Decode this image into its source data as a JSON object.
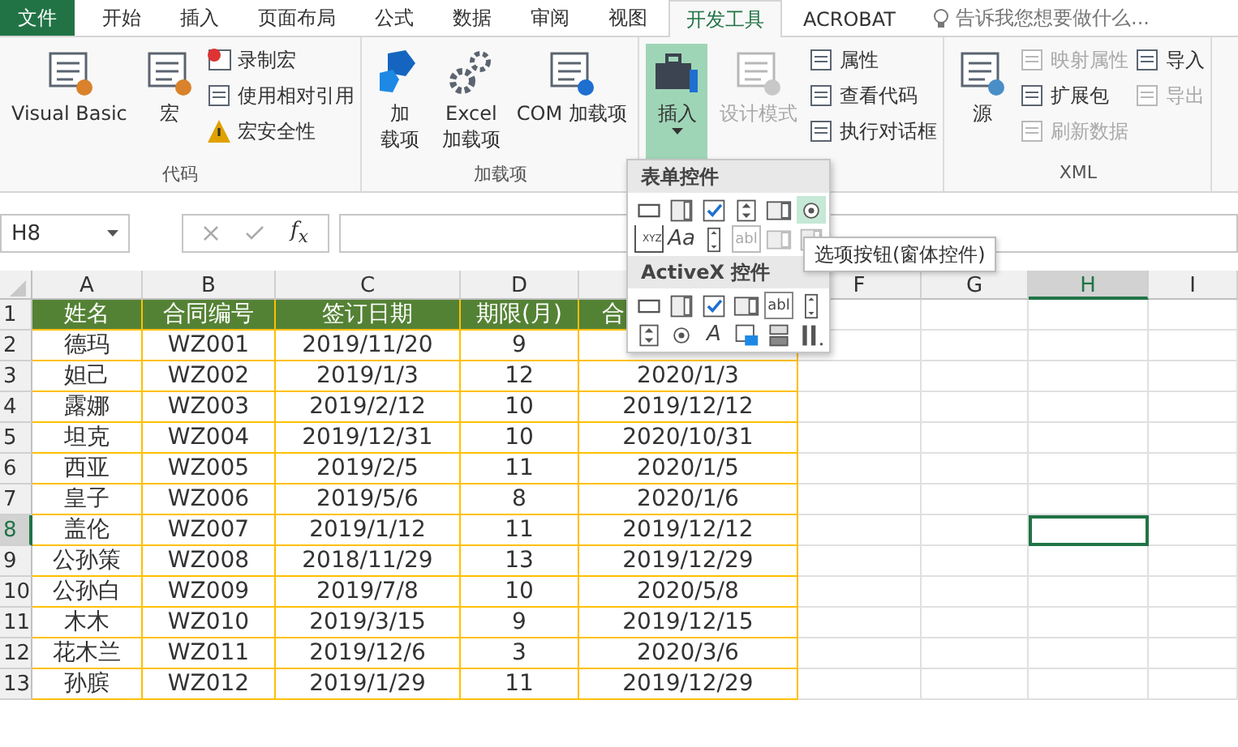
{
  "tabs": [
    {
      "label": "文件",
      "kind": "file",
      "selected": false
    },
    {
      "label": "开始",
      "kind": "tab",
      "selected": false
    },
    {
      "label": "插入",
      "kind": "tab",
      "selected": false
    },
    {
      "label": "页面布局",
      "kind": "tab",
      "selected": false
    },
    {
      "label": "公式",
      "kind": "tab",
      "selected": false
    },
    {
      "label": "数据",
      "kind": "tab",
      "selected": false
    },
    {
      "label": "审阅",
      "kind": "tab",
      "selected": false
    },
    {
      "label": "视图",
      "kind": "tab",
      "selected": false
    },
    {
      "label": "开发工具",
      "kind": "tab",
      "selected": true
    },
    {
      "label": "ACROBAT",
      "kind": "tab",
      "selected": false
    }
  ],
  "tell_me": {
    "placeholder": "告诉我您想要做什么..."
  },
  "ribbon": {
    "groups": [
      {
        "label": "代码",
        "columns": [
          {
            "kind": "large",
            "items": [
              {
                "lines": [
                  "Visual Basic"
                ],
                "disabled": false
              }
            ]
          },
          {
            "kind": "large",
            "items": [
              {
                "lines": [
                  "宏"
                ],
                "disabled": false
              }
            ]
          },
          {
            "kind": "stack",
            "items": [
              {
                "lines": [
                  "录制宏"
                ],
                "disabled": false
              },
              {
                "lines": [
                  "使用相对引用"
                ],
                "disabled": false
              },
              {
                "lines": [
                  "宏安全性"
                ],
                "disabled": false
              }
            ]
          }
        ]
      },
      {
        "label": "加载项",
        "columns": [
          {
            "kind": "large",
            "items": [
              {
                "lines": [
                  "加",
                  "载项"
                ],
                "disabled": false
              }
            ]
          },
          {
            "kind": "large",
            "items": [
              {
                "lines": [
                  "Excel",
                  "加载项"
                ],
                "disabled": false
              }
            ]
          },
          {
            "kind": "large",
            "items": [
              {
                "lines": [
                  "COM 加载项"
                ],
                "disabled": false
              }
            ]
          }
        ]
      },
      {
        "columns": [
          {
            "kind": "large",
            "items": [
              {
                "lines": [
                  "插入"
                ],
                "disabled": false,
                "selected": true,
                "dropdown": true
              }
            ]
          },
          {
            "kind": "large",
            "items": [
              {
                "lines": [
                  "设计模式"
                ],
                "disabled": true
              }
            ]
          },
          {
            "kind": "stack",
            "items": [
              {
                "lines": [
                  "属性"
                ],
                "disabled": false
              },
              {
                "lines": [
                  "查看代码"
                ],
                "disabled": false
              },
              {
                "lines": [
                  "执行对话框"
                ],
                "disabled": false
              }
            ]
          }
        ]
      },
      {
        "label": "XML",
        "columns": [
          {
            "kind": "large",
            "items": [
              {
                "lines": [
                  "源"
                ],
                "disabled": false
              }
            ]
          },
          {
            "kind": "stack",
            "items": [
              {
                "lines": [
                  "映射属性"
                ],
                "disabled": true
              },
              {
                "lines": [
                  "扩展包"
                ],
                "disabled": false
              },
              {
                "lines": [
                  "刷新数据"
                ],
                "disabled": true
              }
            ]
          },
          {
            "kind": "stack",
            "items": [
              {
                "lines": [
                  "导入"
                ],
                "disabled": false
              },
              {
                "lines": [
                  "导出"
                ],
                "disabled": true
              }
            ]
          }
        ]
      }
    ]
  },
  "formula_bar": {
    "name_box": "H8",
    "fx": "f$_{x}$"
  },
  "sheet": {
    "columns": [
      {
        "label": "A",
        "selected": false
      },
      {
        "label": "B",
        "selected": false
      },
      {
        "label": "C",
        "selected": false
      },
      {
        "label": "D",
        "selected": false
      },
      {
        "selected": false
      },
      {
        "label": "F",
        "selected": false
      },
      {
        "label": "G",
        "selected": false
      },
      {
        "label": "H",
        "selected": true
      },
      {
        "label": "I",
        "selected": false
      }
    ],
    "rows": [
      {
        "header": "1",
        "kind": "header",
        "selected": false,
        "cells": [
          "姓名",
          "合同编号",
          "签订日期",
          "期限(月)",
          "合"
        ]
      },
      {
        "header": "2",
        "kind": "data",
        "selected": false,
        "cells": [
          "德玛",
          "WZ001",
          "2019/11/20",
          "9"
        ]
      },
      {
        "header": "3",
        "kind": "data",
        "selected": false,
        "cells": [
          "妲己",
          "WZ002",
          "2019/1/3",
          "12",
          "2020/1/3"
        ]
      },
      {
        "header": "4",
        "kind": "data",
        "selected": false,
        "cells": [
          "露娜",
          "WZ003",
          "2019/2/12",
          "10",
          "2019/12/12"
        ]
      },
      {
        "header": "5",
        "kind": "data",
        "selected": false,
        "cells": [
          "坦克",
          "WZ004",
          "2019/12/31",
          "10",
          "2020/10/31"
        ]
      },
      {
        "header": "6",
        "kind": "data",
        "selected": false,
        "cells": [
          "西亚",
          "WZ005",
          "2019/2/5",
          "11",
          "2020/1/5"
        ]
      },
      {
        "header": "7",
        "kind": "data",
        "selected": false,
        "cells": [
          "皇子",
          "WZ006",
          "2019/5/6",
          "8",
          "2020/1/6"
        ]
      },
      {
        "header": "8",
        "kind": "data",
        "selected": true,
        "cells": [
          "盖伦",
          "WZ007",
          "2019/1/12",
          "11",
          "2019/12/12"
        ]
      },
      {
        "header": "9",
        "kind": "data",
        "selected": false,
        "cells": [
          "公孙策",
          "WZ008",
          "2018/11/29",
          "13",
          "2019/12/29"
        ]
      },
      {
        "header": "10",
        "kind": "data",
        "selected": false,
        "cells": [
          "公孙白",
          "WZ009",
          "2019/7/8",
          "10",
          "2020/5/8"
        ]
      },
      {
        "header": "11",
        "kind": "data",
        "selected": false,
        "cells": [
          "木木",
          "WZ010",
          "2019/3/15",
          "9",
          "2019/12/15"
        ]
      },
      {
        "header": "12",
        "kind": "data",
        "selected": false,
        "cells": [
          "花木兰",
          "WZ011",
          "2019/12/6",
          "3",
          "2020/3/6"
        ]
      },
      {
        "header": "13",
        "kind": "data",
        "selected": false,
        "cells": [
          "孙膑",
          "WZ012",
          "2019/1/29",
          "11",
          "2019/12/29"
        ]
      }
    ],
    "active": true
  },
  "insert_menu": {
    "sections": [
      {
        "title": "表单控件",
        "controls": [
          {
            "kind": "button",
            "selected": false,
            "disabled": false
          },
          {
            "kind": "combo",
            "selected": false,
            "disabled": false
          },
          {
            "kind": "check",
            "selected": false,
            "disabled": false
          },
          {
            "kind": "spin",
            "selected": false,
            "disabled": false
          },
          {
            "kind": "list",
            "selected": false,
            "disabled": false
          },
          {
            "kind": "radio",
            "selected": true,
            "disabled": false
          },
          {
            "kind": "group",
            "glyph": "XYZ",
            "selected": false,
            "disabled": false
          },
          {
            "kind": "label",
            "glyph": "Aa",
            "selected": false,
            "disabled": false
          },
          {
            "kind": "scroll",
            "selected": false,
            "disabled": false
          },
          {
            "kind": "textfield",
            "glyph": "abl",
            "selected": false,
            "disabled": true
          },
          {
            "kind": "list",
            "selected": false,
            "disabled": true
          },
          {
            "kind": "combo",
            "selected": false,
            "disabled": true
          }
        ]
      },
      {
        "title": "ActiveX 控件",
        "controls": [
          {
            "kind": "button",
            "selected": false,
            "disabled": false
          },
          {
            "kind": "combo",
            "selected": false,
            "disabled": false
          },
          {
            "kind": "check",
            "selected": false,
            "disabled": false
          },
          {
            "kind": "list",
            "selected": false,
            "disabled": false
          },
          {
            "kind": "textfield",
            "glyph": "abl",
            "selected": false,
            "disabled": false
          },
          {
            "kind": "scroll",
            "selected": false,
            "disabled": false
          },
          {
            "kind": "spin",
            "selected": false,
            "disabled": false
          },
          {
            "kind": "radio",
            "selected": false,
            "disabled": false
          },
          {
            "kind": "label",
            "glyph": "A",
            "selected": false,
            "disabled": false
          },
          {
            "kind": "image",
            "selected": false,
            "disabled": false
          },
          {
            "kind": "toggle",
            "selected": false,
            "disabled": false
          },
          {
            "kind": "more",
            "selected": false,
            "disabled": false
          }
        ]
      }
    ]
  },
  "tooltip": "选项按钮(窗体控件)"
}
